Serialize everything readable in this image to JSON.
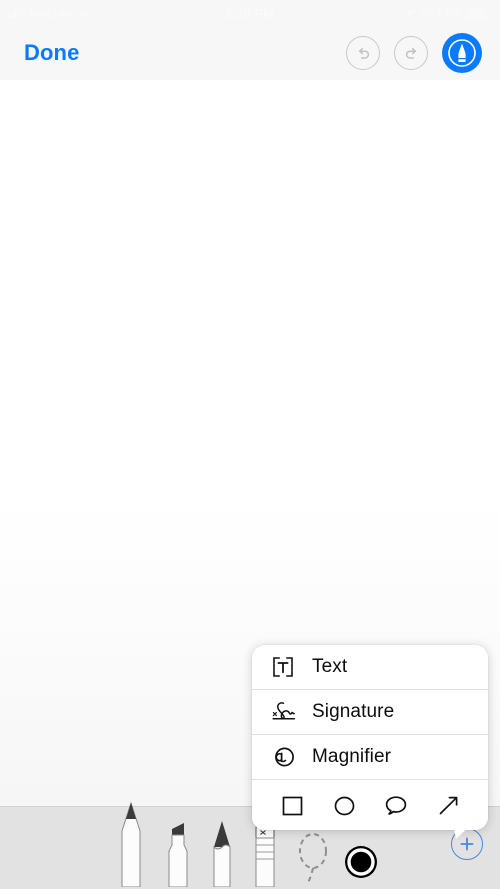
{
  "status_bar": {
    "carrier": "Verizon",
    "time": "2:10 PM",
    "battery_percent": "74%",
    "signal_icon": "signal-bars-icon",
    "wifi_icon": "wifi-icon",
    "location_icon": "location-arrow-icon",
    "alarm_icon": "alarm-clock-icon",
    "battery_icon": "battery-icon"
  },
  "nav_bar": {
    "done_label": "Done",
    "undo_icon": "undo-arrow-icon",
    "redo_icon": "redo-arrow-icon",
    "markup_icon": "markup-pen-icon",
    "undo_enabled": "false",
    "redo_enabled": "false",
    "accent_color": "#0a7aff"
  },
  "popup_menu": {
    "items": [
      {
        "label": "Text",
        "icon": "text-box-icon"
      },
      {
        "label": "Signature",
        "icon": "signature-icon"
      },
      {
        "label": "Magnifier",
        "icon": "magnifier-icon"
      }
    ],
    "shapes": [
      {
        "name": "square-shape-icon"
      },
      {
        "name": "circle-shape-icon"
      },
      {
        "name": "speech-bubble-shape-icon"
      },
      {
        "name": "arrow-shape-icon"
      }
    ]
  },
  "tool_bar": {
    "tools": [
      {
        "name": "pen-tool"
      },
      {
        "name": "highlighter-tool"
      },
      {
        "name": "pencil-tool"
      },
      {
        "name": "eraser-tool"
      },
      {
        "name": "lasso-tool"
      }
    ],
    "color_swatch": {
      "name": "color-swatch",
      "color": "#000000"
    },
    "add_button": {
      "name": "add-annotation-button",
      "icon": "plus-icon",
      "color": "#4a86d8"
    },
    "background_color": "#e2e2e2"
  }
}
